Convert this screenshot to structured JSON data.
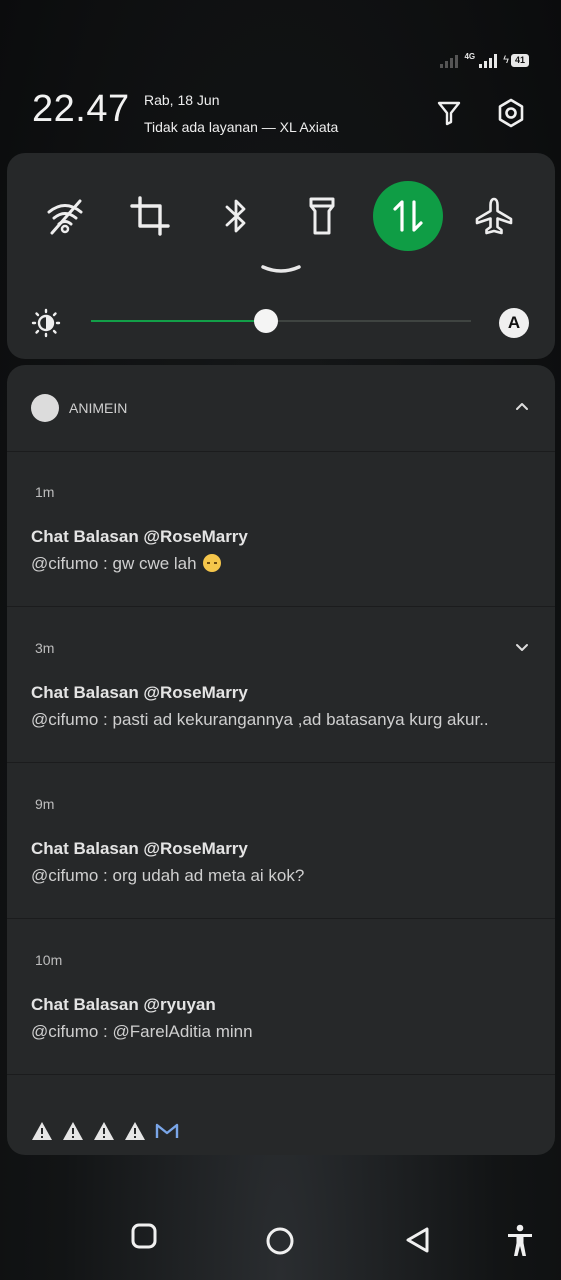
{
  "status_bar": {
    "network_type": "4G",
    "battery_level": "41"
  },
  "header": {
    "time": "22.47",
    "date": "Rab, 18 Jun",
    "carrier": "Tidak ada layanan — XL Axiata"
  },
  "quick_settings": {
    "tiles": [
      {
        "icon": "wifi-off-icon",
        "active": false
      },
      {
        "icon": "crop-icon",
        "active": false
      },
      {
        "icon": "bluetooth-icon",
        "active": false
      },
      {
        "icon": "flashlight-icon",
        "active": false
      },
      {
        "icon": "mobile-data-icon",
        "active": true
      },
      {
        "icon": "airplane-icon",
        "active": false
      }
    ],
    "brightness_level": 0.46,
    "auto_brightness_label": "A",
    "accent_color": "#0f9d45"
  },
  "notification_group": {
    "app_name": "ANIMEIN",
    "items": [
      {
        "time": "1m",
        "title": "Chat Balasan @RoseMarry",
        "body": "@cifumo : gw cwe lah",
        "emoji": true,
        "expandable": false
      },
      {
        "time": "3m",
        "title": "Chat Balasan @RoseMarry",
        "body": "@cifumo : pasti ad kekurangannya ,ad batasanya kurg akur..",
        "emoji": false,
        "expandable": true
      },
      {
        "time": "9m",
        "title": "Chat Balasan @RoseMarry",
        "body": "@cifumo : org udah ad meta ai kok?",
        "emoji": false,
        "expandable": false
      },
      {
        "time": "10m",
        "title": "Chat Balasan @ryuyan",
        "body": "@cifumo : @FarelAditia minn",
        "emoji": false,
        "expandable": false
      }
    ],
    "footer_icons": [
      "warning-icon",
      "warning-icon",
      "warning-icon",
      "warning-icon",
      "gmail-icon"
    ]
  },
  "navigation": {
    "buttons": [
      "recents-button",
      "home-button",
      "back-button",
      "accessibility-button"
    ]
  }
}
